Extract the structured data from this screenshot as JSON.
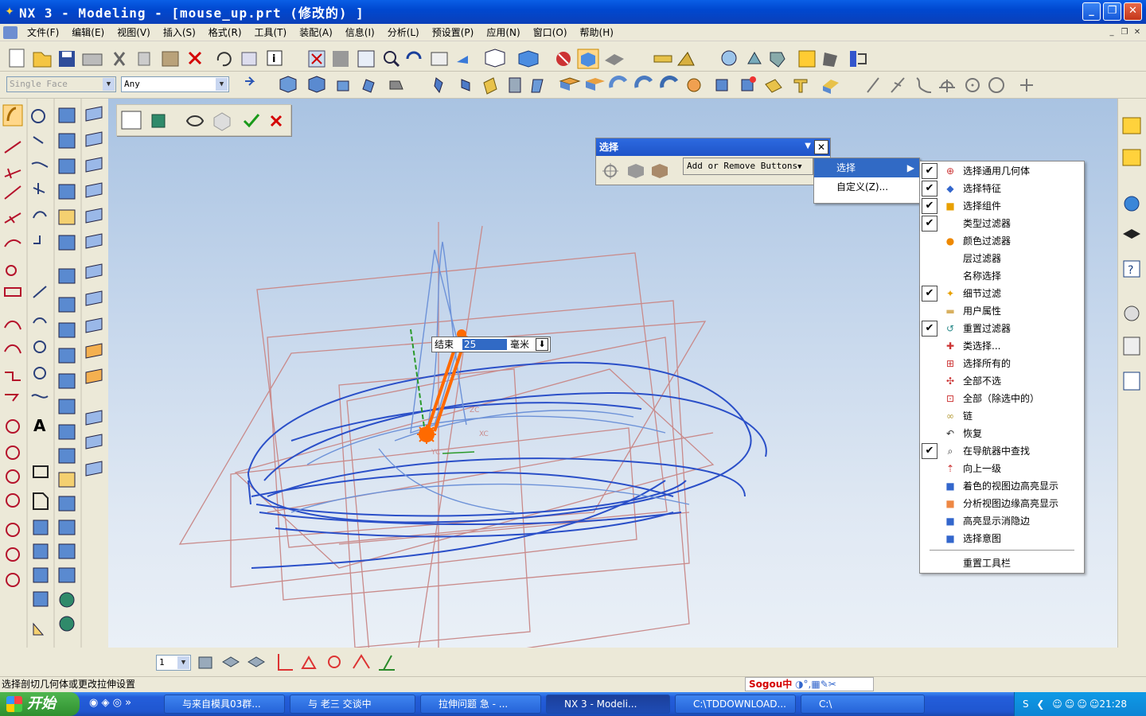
{
  "window": {
    "title": "NX 3 - Modeling - [mouse_up.prt  (修改的) ]",
    "min": "_",
    "max": "❐",
    "close": "✕"
  },
  "menubar": {
    "items": [
      "文件(F)",
      "编辑(E)",
      "视图(V)",
      "插入(S)",
      "格式(R)",
      "工具(T)",
      "装配(A)",
      "信息(I)",
      "分析(L)",
      "预设置(P)",
      "应用(N)",
      "窗口(O)",
      "帮助(H)"
    ]
  },
  "filters": {
    "type_filter": "Single Face",
    "scope": "Any"
  },
  "selection_toolbar": {
    "title": "选择",
    "add_remove": "Add or Remove Buttons"
  },
  "submenu": {
    "items": [
      "选择",
      "自定义(Z)..."
    ]
  },
  "context_menu": {
    "items": [
      {
        "label": "选择通用几何体",
        "checked": true,
        "icon": "crosshair-icon"
      },
      {
        "label": "选择特征",
        "checked": true,
        "icon": "feature-icon"
      },
      {
        "label": "选择组件",
        "checked": true,
        "icon": "component-icon"
      },
      {
        "label": "类型过滤器",
        "checked": true,
        "icon": ""
      },
      {
        "label": "颜色过滤器",
        "checked": false,
        "icon": "palette-icon"
      },
      {
        "label": "层过滤器",
        "checked": false,
        "icon": ""
      },
      {
        "label": "名称选择",
        "checked": false,
        "icon": ""
      },
      {
        "label": "细节过滤",
        "checked": true,
        "icon": "detail-filter-icon"
      },
      {
        "label": "用户属性",
        "checked": false,
        "icon": "attribute-icon"
      },
      {
        "label": "重置过滤器",
        "checked": true,
        "icon": "reset-icon"
      },
      {
        "label": "类选择...",
        "checked": false,
        "icon": "class-select-icon"
      },
      {
        "label": "选择所有的",
        "checked": false,
        "icon": "select-all-icon"
      },
      {
        "label": "全部不选",
        "checked": false,
        "icon": "deselect-all-icon"
      },
      {
        "label": "全部（除选中的）",
        "checked": false,
        "icon": "select-inverse-icon"
      },
      {
        "label": "链",
        "checked": false,
        "icon": "chain-icon"
      },
      {
        "label": "恢复",
        "checked": false,
        "icon": "restore-icon"
      },
      {
        "label": "在导航器中查找",
        "checked": true,
        "icon": "navigator-find-icon"
      },
      {
        "label": "向上一级",
        "checked": false,
        "icon": "up-level-icon"
      },
      {
        "label": "着色的视图边高亮显示",
        "checked": false,
        "icon": "shaded-edge-icon"
      },
      {
        "label": "分析视图边缘高亮显示",
        "checked": false,
        "icon": "analysis-edge-icon"
      },
      {
        "label": "高亮显示消隐边",
        "checked": false,
        "icon": "hidden-edge-icon"
      },
      {
        "label": "选择意图",
        "checked": false,
        "icon": "intent-icon"
      }
    ],
    "reset": "重置工具栏"
  },
  "end_box": {
    "label": "结束",
    "value": "25",
    "unit": "毫米"
  },
  "bottom_toolbar": {
    "layer": "1"
  },
  "status_text": "选择剖切几何体或更改拉伸设置",
  "taskbar": {
    "start": "开始",
    "tasks": [
      "与来自模具03群...",
      "与 老三 交谈中",
      "拉伸问题 急 - ...",
      "NX 3 - Modeli...",
      "C:\\TDDOWNLOAD...",
      "C:\\"
    ],
    "clock": "21:28",
    "ime": "Sogou中"
  },
  "colors": {
    "accent": "#316ac5",
    "title": "#0048d0",
    "curve": "#1b3fc0",
    "plane": "#c98a8a",
    "orange": "#ff6a00"
  }
}
